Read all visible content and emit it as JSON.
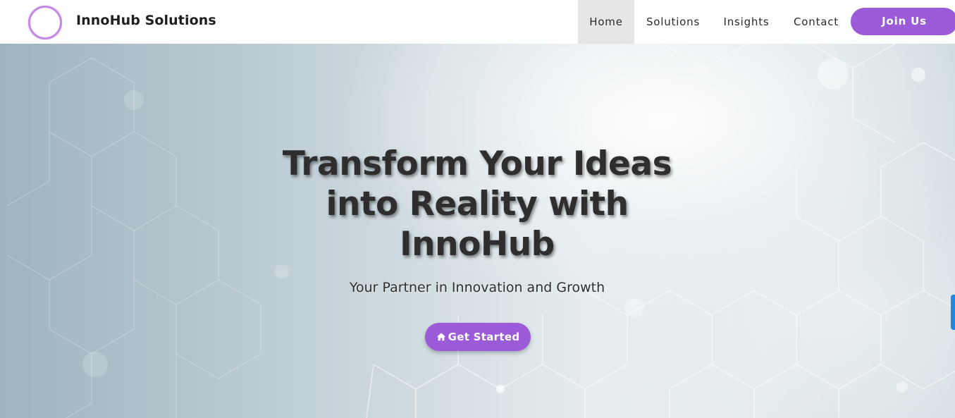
{
  "header": {
    "brand_name": "InnoHub Solutions",
    "nav": {
      "home": "Home",
      "solutions": "Solutions",
      "insights": "Insights",
      "contact": "Contact"
    },
    "join_label": "Join Us"
  },
  "hero": {
    "title": "Transform Your Ideas into Reality with InnoHub",
    "subtitle": "Your Partner in Innovation and Growth",
    "cta_label": "Get Started",
    "cta_icon": "home-icon"
  },
  "colors": {
    "accent": "#9b5ad8",
    "logo_ring": "#c28ae4",
    "active_nav_bg": "#e6e6e6",
    "side_tab": "#1f88e5"
  }
}
